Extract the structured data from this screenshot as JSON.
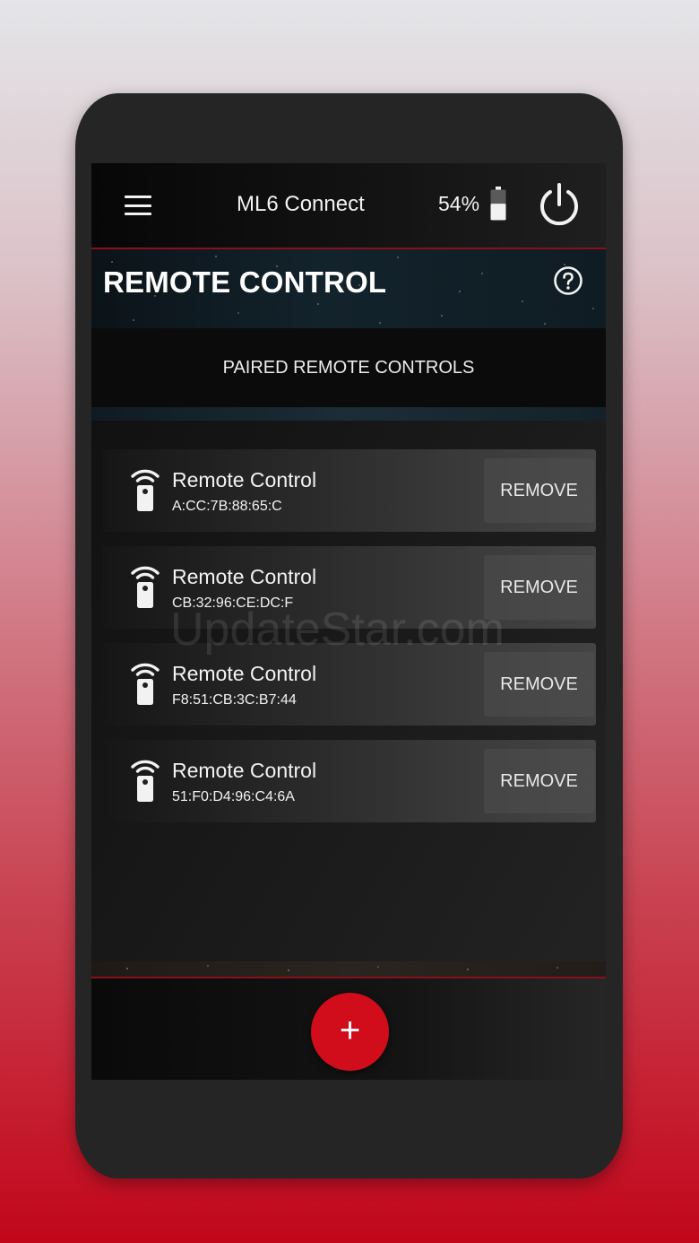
{
  "app_bar": {
    "title": "ML6 Connect",
    "battery_percent": "54%",
    "battery_level": 0.54,
    "icons": {
      "menu": "menu-icon",
      "battery": "battery-icon",
      "power": "power-icon"
    }
  },
  "banner": {
    "title": "REMOTE CONTROL",
    "help_icon": "question-circle-icon"
  },
  "subheader": "PAIRED REMOTE CONTROLS",
  "devices": [
    {
      "name": "Remote Control",
      "address": "A:CC:7B:88:65:C",
      "action": "REMOVE"
    },
    {
      "name": "Remote Control",
      "address": "CB:32:96:CE:DC:F",
      "action": "REMOVE"
    },
    {
      "name": "Remote Control",
      "address": "F8:51:CB:3C:B7:44",
      "action": "REMOVE"
    },
    {
      "name": "Remote Control",
      "address": "51:F0:D4:96:C4:6A",
      "action": "REMOVE"
    }
  ],
  "fab": {
    "label": "+",
    "icon": "add-icon"
  },
  "watermark": "UpdateStar.com",
  "colors": {
    "accent": "#d10d1b",
    "background": "#1a1a1a",
    "text": "#f2f2f2"
  }
}
